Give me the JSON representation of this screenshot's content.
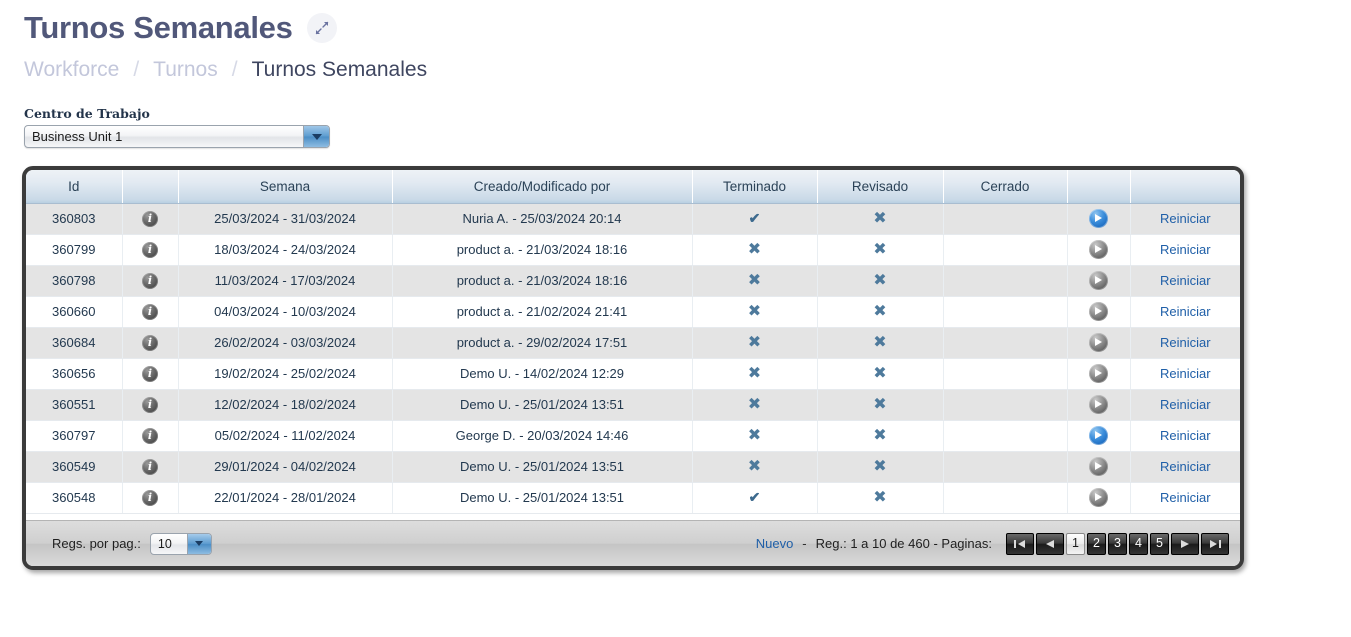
{
  "header": {
    "title": "Turnos Semanales",
    "expand_icon": "expand-arrows-icon",
    "breadcrumb": [
      {
        "label": "Workforce",
        "current": false
      },
      {
        "label": "/",
        "sep": true
      },
      {
        "label": "Turnos",
        "current": false
      },
      {
        "label": "/",
        "sep": true
      },
      {
        "label": "Turnos Semanales",
        "current": true
      }
    ]
  },
  "filter": {
    "label": "Centro de Trabajo",
    "selected": "Business Unit 1",
    "arrow_icon": "chevron-down-icon"
  },
  "grid": {
    "columns": [
      "Id",
      "",
      "Semana",
      "Creado/Modificado por",
      "Terminado",
      "Revisado",
      "Cerrado",
      "",
      ""
    ],
    "rows": [
      {
        "id": "360803",
        "info": "info-icon",
        "semana": "25/03/2024 - 31/03/2024",
        "autor": "Nuria A. - 25/03/2024 20:14",
        "terminado": "check",
        "revisado": "cross",
        "cerrado": "",
        "go": "blue",
        "action": "Reiniciar"
      },
      {
        "id": "360799",
        "info": "info-icon",
        "semana": "18/03/2024 - 24/03/2024",
        "autor": "product a. - 21/03/2024 18:16",
        "terminado": "cross",
        "revisado": "cross",
        "cerrado": "",
        "go": "grey",
        "action": "Reiniciar"
      },
      {
        "id": "360798",
        "info": "info-icon",
        "semana": "11/03/2024 - 17/03/2024",
        "autor": "product a. - 21/03/2024 18:16",
        "terminado": "cross",
        "revisado": "cross",
        "cerrado": "",
        "go": "grey",
        "action": "Reiniciar"
      },
      {
        "id": "360660",
        "info": "info-icon",
        "semana": "04/03/2024 - 10/03/2024",
        "autor": "product a. - 21/02/2024 21:41",
        "terminado": "cross",
        "revisado": "cross",
        "cerrado": "",
        "go": "grey",
        "action": "Reiniciar"
      },
      {
        "id": "360684",
        "info": "info-icon",
        "semana": "26/02/2024 - 03/03/2024",
        "autor": "product a. - 29/02/2024 17:51",
        "terminado": "cross",
        "revisado": "cross",
        "cerrado": "",
        "go": "grey",
        "action": "Reiniciar"
      },
      {
        "id": "360656",
        "info": "info-icon",
        "semana": "19/02/2024 - 25/02/2024",
        "autor": "Demo U. - 14/02/2024 12:29",
        "terminado": "cross",
        "revisado": "cross",
        "cerrado": "",
        "go": "grey",
        "action": "Reiniciar"
      },
      {
        "id": "360551",
        "info": "info-icon",
        "semana": "12/02/2024 - 18/02/2024",
        "autor": "Demo U. - 25/01/2024 13:51",
        "terminado": "cross",
        "revisado": "cross",
        "cerrado": "",
        "go": "grey",
        "action": "Reiniciar"
      },
      {
        "id": "360797",
        "info": "info-icon",
        "semana": "05/02/2024 - 11/02/2024",
        "autor": "George D. - 20/03/2024 14:46",
        "terminado": "cross",
        "revisado": "cross",
        "cerrado": "",
        "go": "blue",
        "action": "Reiniciar"
      },
      {
        "id": "360549",
        "info": "info-icon",
        "semana": "29/01/2024 - 04/02/2024",
        "autor": "Demo U. - 25/01/2024 13:51",
        "terminado": "cross",
        "revisado": "cross",
        "cerrado": "",
        "go": "grey",
        "action": "Reiniciar"
      },
      {
        "id": "360548",
        "info": "info-icon",
        "semana": "22/01/2024 - 28/01/2024",
        "autor": "Demo U. - 25/01/2024 13:51",
        "terminado": "check",
        "revisado": "cross",
        "cerrado": "",
        "go": "grey",
        "action": "Reiniciar"
      }
    ]
  },
  "footer": {
    "rows_per_page_label": "Regs. por pag.:",
    "rows_per_page_value": "10",
    "new_link": "Nuevo",
    "separator": "-",
    "record_info": "Reg.: 1 a 10 de 460 - Paginas:",
    "pages": [
      "1",
      "2",
      "3",
      "4",
      "5"
    ],
    "current_page": "1",
    "nav_first_icon": "go-first-icon",
    "nav_prev_icon": "go-prev-icon",
    "nav_next_icon": "go-next-icon",
    "nav_last_icon": "go-last-icon"
  },
  "colors": {
    "title": "#51587a",
    "breadcrumb_muted": "#c3c7db",
    "link": "#1f5fa8",
    "mark": "#4e7a9c",
    "go_blue": "#2f7fd0",
    "go_grey": "#6e6e6e"
  }
}
